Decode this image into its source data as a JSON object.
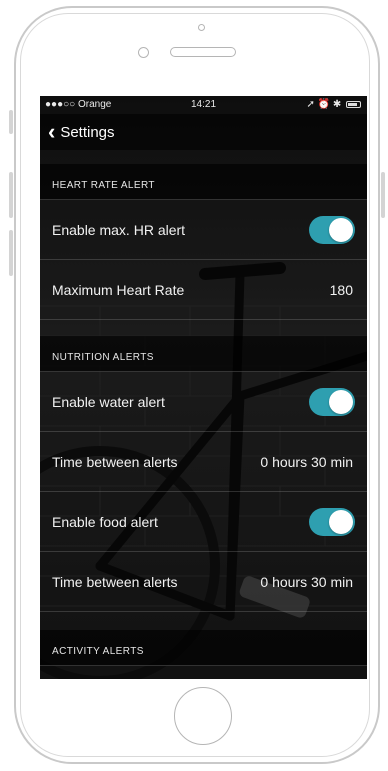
{
  "status_bar": {
    "carrier": "●●●○○ Orange",
    "time": "14:21",
    "icons": "➚ ⏰ ✱"
  },
  "nav": {
    "back_label": "Settings"
  },
  "sections": {
    "heart_rate": {
      "header": "HEART RATE ALERT",
      "enable_label": "Enable max. HR alert",
      "enable_on": true,
      "max_label": "Maximum Heart Rate",
      "max_value": "180"
    },
    "nutrition": {
      "header": "NUTRITION ALERTS",
      "water_label": "Enable water alert",
      "water_on": true,
      "water_interval_label": "Time between alerts",
      "water_interval_value": "0 hours 30 min",
      "food_label": "Enable food alert",
      "food_on": true,
      "food_interval_label": "Time between alerts",
      "food_interval_value": "0 hours 30 min"
    },
    "activity": {
      "header": "ACTIVITY ALERTS"
    }
  },
  "colors": {
    "toggle_on": "#2e9fb0"
  }
}
